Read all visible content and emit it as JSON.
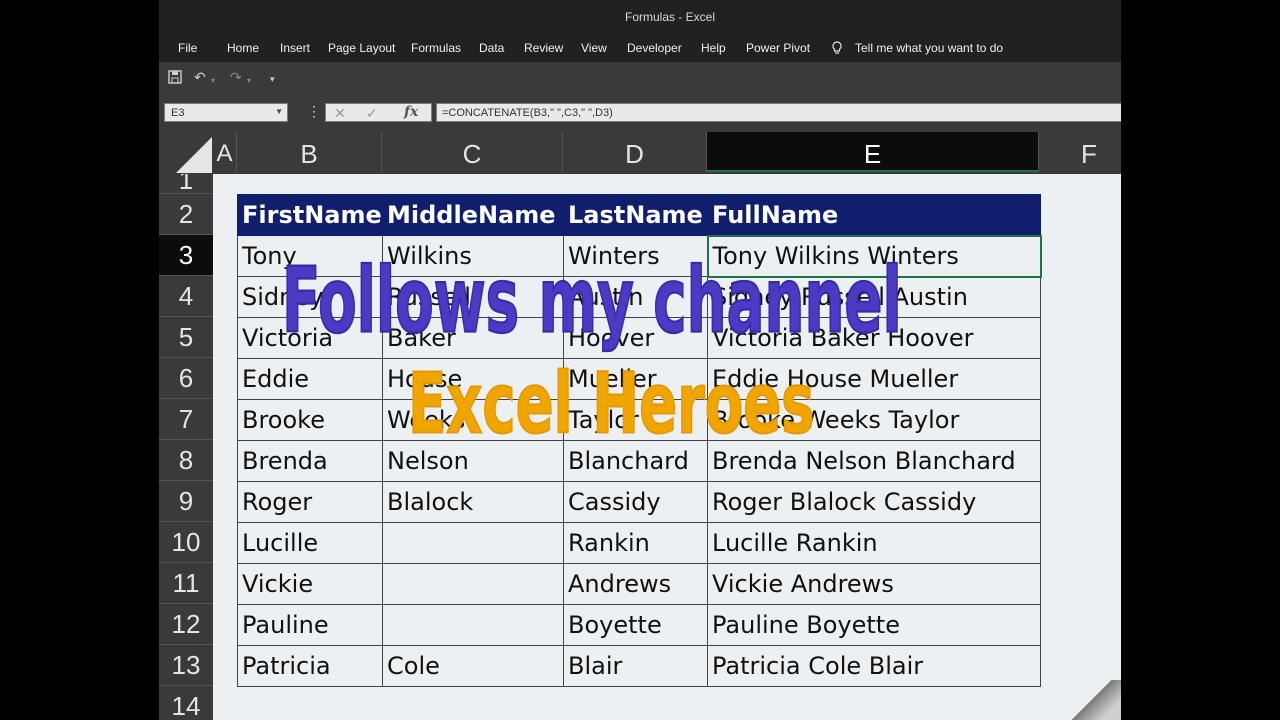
{
  "window": {
    "title": "Formulas  -  Excel"
  },
  "menu": [
    "File",
    "Home",
    "Insert",
    "Page Layout",
    "Formulas",
    "Data",
    "Review",
    "View",
    "Developer",
    "Help",
    "Power Pivot"
  ],
  "tell_me": "Tell me what you want to do",
  "quick_access": {
    "save_icon": "save-icon",
    "undo_icon": "undo-icon",
    "redo_icon": "redo-icon",
    "customize_icon": "customize-icon"
  },
  "formula_bar": {
    "name_box": "E3",
    "fx_label": "fx",
    "formula": "=CONCATENATE(B3,\" \",C3,\" \",D3)"
  },
  "columns": [
    "A",
    "B",
    "C",
    "D",
    "E",
    "F"
  ],
  "active_column": "E",
  "rows": [
    "1",
    "2",
    "3",
    "4",
    "5",
    "6",
    "7",
    "8",
    "9",
    "10",
    "11",
    "12",
    "13",
    "14"
  ],
  "active_row": "3",
  "table": {
    "headers": [
      "FirstName",
      "MiddleName",
      "LastName",
      "FullName"
    ],
    "rows": [
      [
        "Tony",
        "Wilkins",
        "Winters",
        "Tony Wilkins Winters"
      ],
      [
        "Sidney",
        "Russell",
        "Austin",
        "Sidney Russell Austin"
      ],
      [
        "Victoria",
        "Baker",
        "Hoover",
        "Victoria Baker Hoover"
      ],
      [
        "Eddie",
        "House",
        "Mueller",
        "Eddie House Mueller"
      ],
      [
        "Brooke",
        "Weeks",
        "Taylor",
        "Brooke Weeks Taylor"
      ],
      [
        "Brenda",
        "Nelson",
        "Blanchard",
        "Brenda Nelson Blanchard"
      ],
      [
        "Roger",
        "Blalock",
        "Cassidy",
        "Roger Blalock Cassidy"
      ],
      [
        "Lucille",
        "",
        "Rankin",
        "Lucille  Rankin"
      ],
      [
        "Vickie",
        "",
        "Andrews",
        "Vickie  Andrews"
      ],
      [
        "Pauline",
        "",
        "Boyette",
        "Pauline  Boyette"
      ],
      [
        "Patricia",
        "Cole",
        "Blair",
        "Patricia Cole Blair"
      ]
    ]
  },
  "overlay": {
    "line1": "Follows my channel",
    "line2": "Excel Heroes"
  },
  "colors": {
    "header_fill": "#0f1f6e",
    "overlay_purple": "#4a3ac4",
    "overlay_orange": "#f0a500",
    "selection": "#217346"
  }
}
